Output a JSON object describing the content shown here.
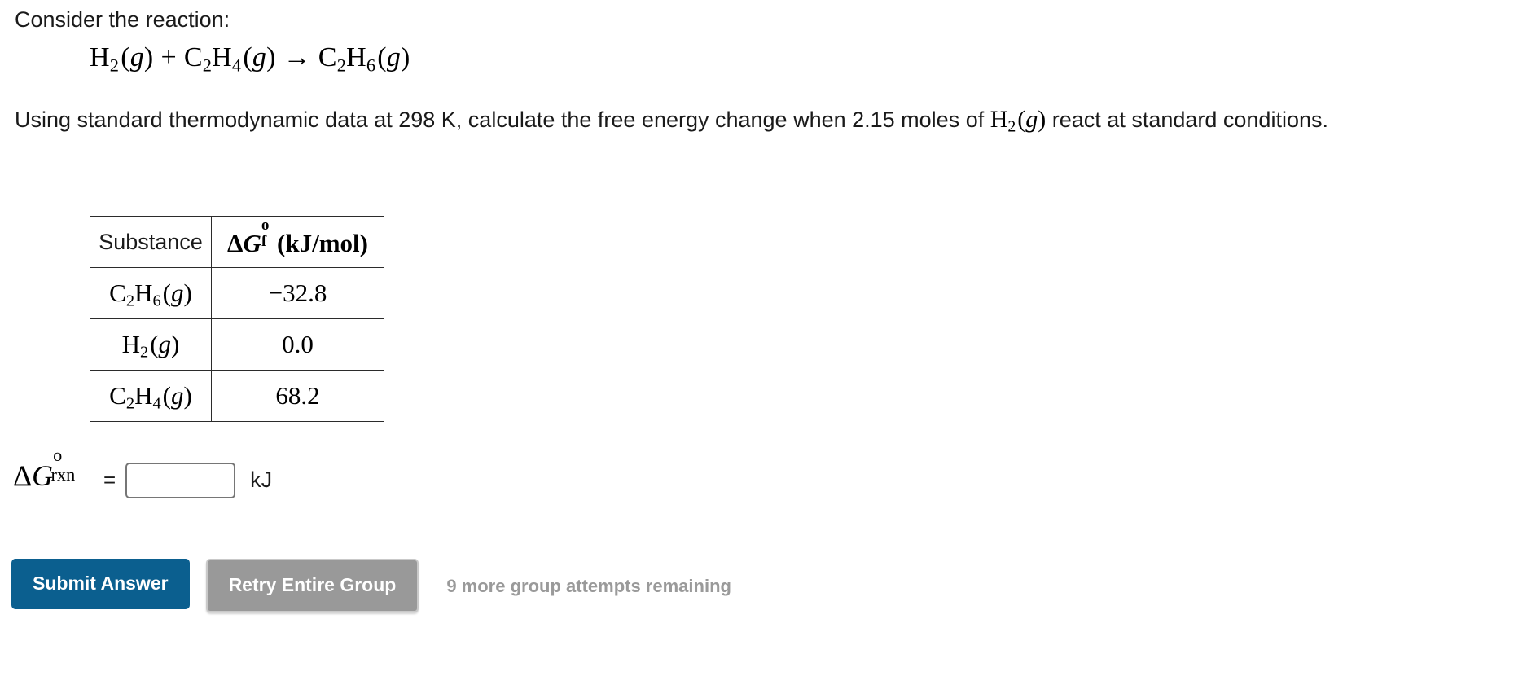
{
  "intro": {
    "consider_line": "Consider the reaction:"
  },
  "reaction": {
    "reactant1": {
      "element1": "H",
      "sub1": "2",
      "state": "g"
    },
    "plus": "+",
    "reactant2": {
      "element1": "C",
      "sub1": "2",
      "element2": "H",
      "sub2": "4",
      "state": "g"
    },
    "arrow": "→",
    "product": {
      "element1": "C",
      "sub1": "2",
      "element2": "H",
      "sub2": "6",
      "state": "g"
    },
    "plain_text": "H2(g) + C2H4(g) → C2H6(g)"
  },
  "question": {
    "part1": "Using standard thermodynamic data at 298 K, calculate the free energy change when 2.15 moles of ",
    "inline_species": {
      "element": "H",
      "sub": "2",
      "state": "g"
    },
    "part2": " react at standard conditions.",
    "temperature": "298 K",
    "moles": "2.15"
  },
  "table": {
    "headers": {
      "substance": "Substance",
      "delta_g_symbol": "ΔG",
      "delta_g_superscript": "o",
      "delta_g_subscript": "f",
      "units": "(kJ/mol)",
      "full_text": "ΔG°f (kJ/mol)"
    },
    "rows": [
      {
        "formula_parts": [
          {
            "text": "C",
            "type": "element"
          },
          {
            "text": "2",
            "type": "sub"
          },
          {
            "text": "H",
            "type": "element"
          },
          {
            "text": "6",
            "type": "sub"
          },
          {
            "text": "g",
            "type": "state"
          }
        ],
        "formula_text": "C2H6(g)",
        "value": "−32.8"
      },
      {
        "formula_parts": [
          {
            "text": "H",
            "type": "element"
          },
          {
            "text": "2",
            "type": "sub"
          },
          {
            "text": "g",
            "type": "state"
          }
        ],
        "formula_text": "H2(g)",
        "value": "0.0"
      },
      {
        "formula_parts": [
          {
            "text": "C",
            "type": "element"
          },
          {
            "text": "2",
            "type": "sub"
          },
          {
            "text": "H",
            "type": "element"
          },
          {
            "text": "4",
            "type": "sub"
          },
          {
            "text": "g",
            "type": "state"
          }
        ],
        "formula_text": "C2H4(g)",
        "value": "68.2"
      }
    ]
  },
  "answer": {
    "label_symbol": "ΔG",
    "label_superscript": "o",
    "label_subscript": "rxn",
    "label_full": "ΔG°rxn",
    "equals": "=",
    "value": "",
    "placeholder": "",
    "unit": "kJ"
  },
  "actions": {
    "submit_label": "Submit Answer",
    "retry_label": "Retry Entire Group",
    "attempts_text": "9 more group attempts remaining",
    "attempts_count": "9"
  },
  "colors": {
    "submit_blue": "#0b5f8f",
    "retry_gray": "#999999",
    "attempts_gray": "#9a9a9a",
    "text": "#1a1a1a",
    "border": "#2b2b2b",
    "input_border": "#767676"
  }
}
